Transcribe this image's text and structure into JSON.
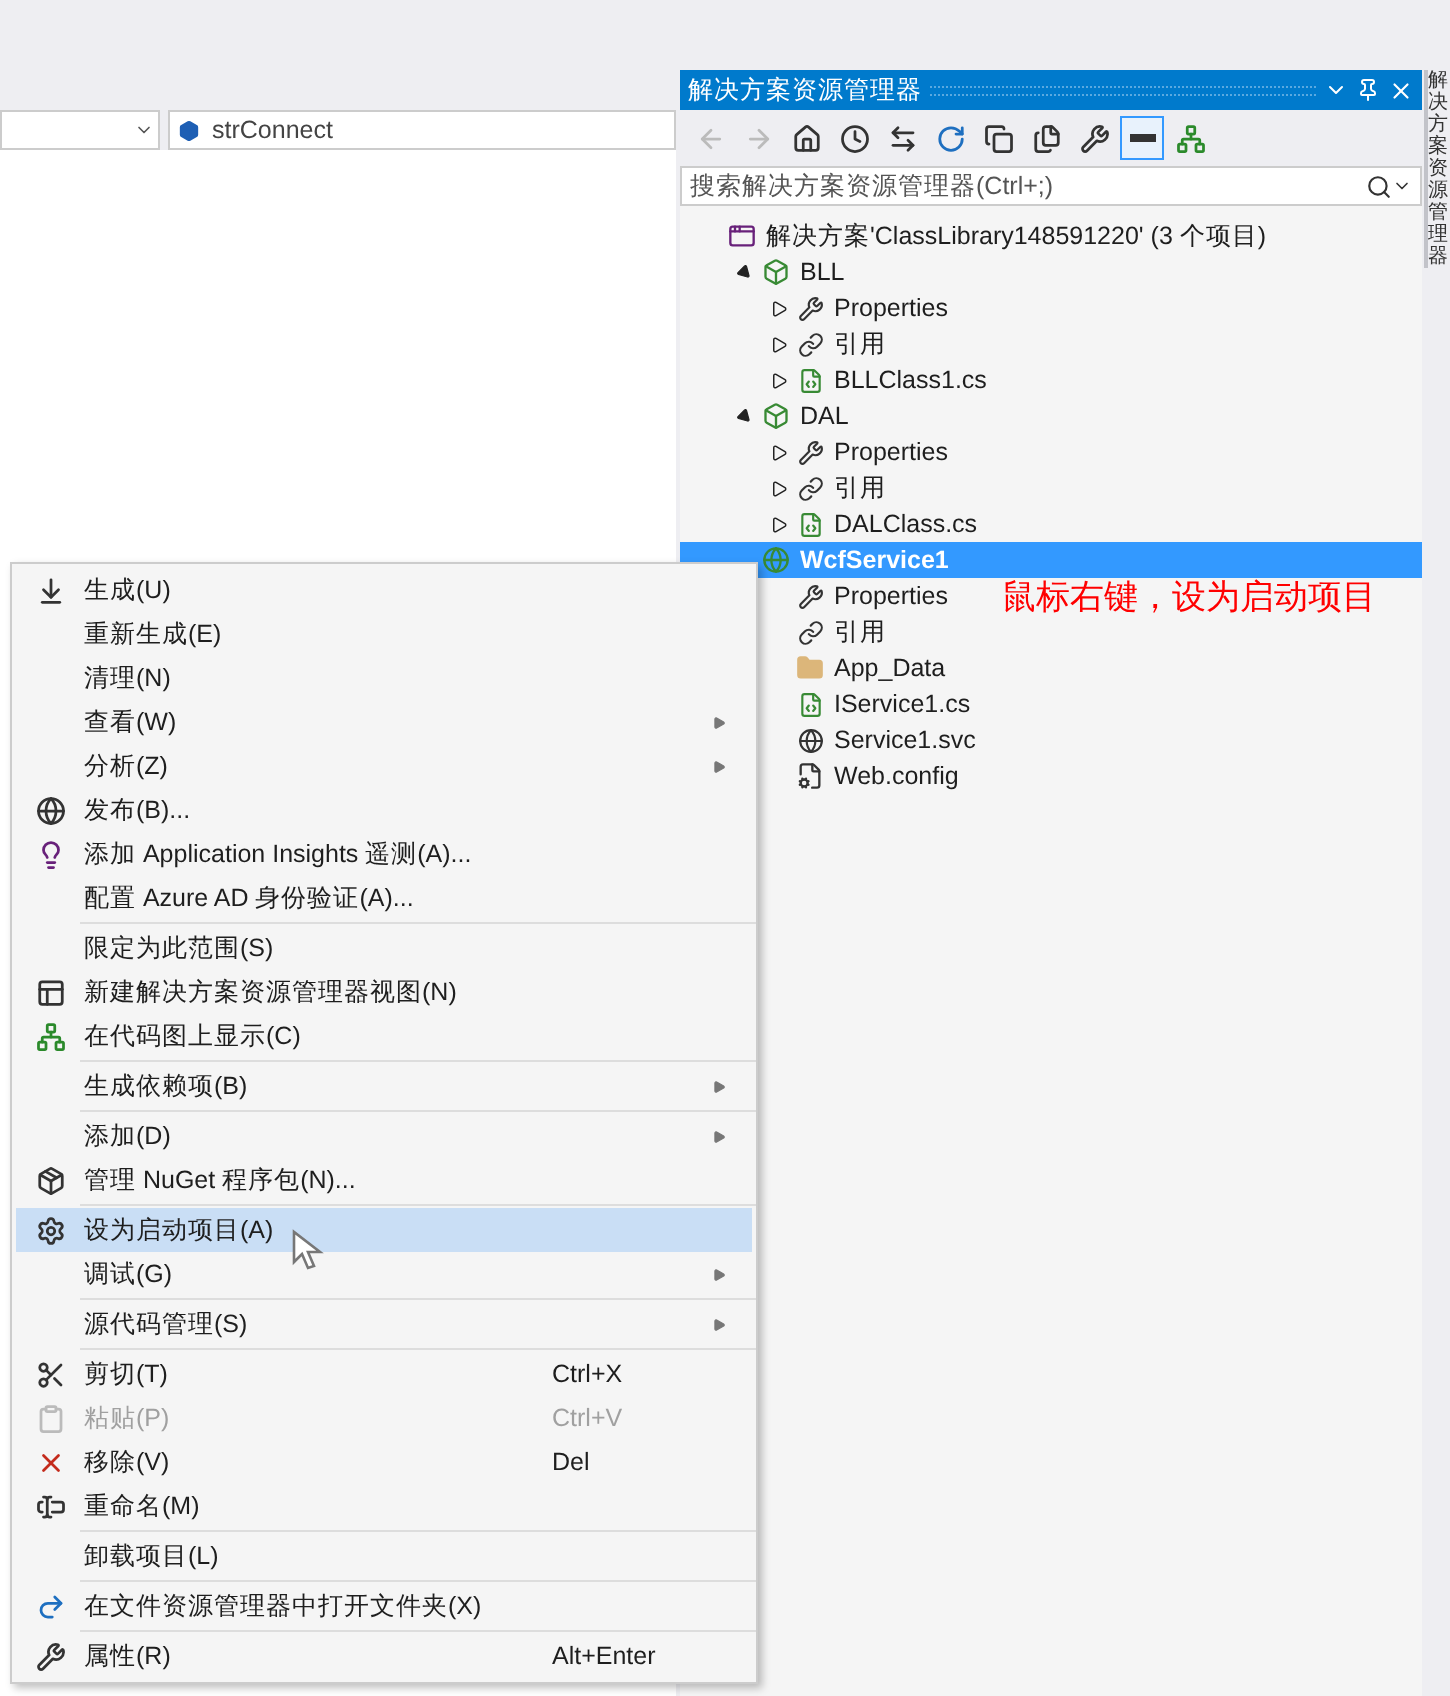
{
  "editor": {
    "member_combo": "strConnect"
  },
  "explorer": {
    "title": "解决方案资源管理器",
    "side_tab": "解决方案资源管理器",
    "toolbar": [
      {
        "kind": "back",
        "selected": false
      },
      {
        "kind": "forward",
        "selected": false
      },
      {
        "kind": "home",
        "selected": false
      },
      {
        "kind": "history",
        "selected": false
      },
      {
        "kind": "sync",
        "selected": false
      },
      {
        "kind": "refresh",
        "selected": false
      },
      {
        "kind": "collapse",
        "selected": false
      },
      {
        "kind": "showall",
        "selected": false
      },
      {
        "kind": "properties",
        "selected": false
      },
      {
        "kind": "preview",
        "selected": true
      },
      {
        "kind": "codemap",
        "selected": false
      }
    ],
    "search": {
      "placeholder": "搜索解决方案资源管理器(Ctrl+;)"
    },
    "tree": [
      {
        "kind": "solution",
        "label": "解决方案'ClassLibrary148591220' (3 个项目)",
        "selected": false,
        "children": [
          {
            "kind": "project",
            "label": "BLL",
            "expanded": true,
            "selected": false,
            "children": [
              {
                "kind": "wrench",
                "label": "Properties",
                "expanded": false,
                "selected": false
              },
              {
                "kind": "reference",
                "label": "引用",
                "expanded": false,
                "selected": false
              },
              {
                "kind": "csfile",
                "label": "BLLClass1.cs",
                "expanded": false,
                "selected": false
              }
            ]
          },
          {
            "kind": "project",
            "label": "DAL",
            "expanded": true,
            "selected": false,
            "children": [
              {
                "kind": "wrench",
                "label": "Properties",
                "expanded": false,
                "selected": false
              },
              {
                "kind": "reference",
                "label": "引用",
                "expanded": false,
                "selected": false
              },
              {
                "kind": "csfile",
                "label": "DALClass.cs",
                "expanded": false,
                "selected": false
              }
            ]
          },
          {
            "kind": "webproject",
            "label": "WcfService1",
            "selected": true,
            "children": [
              {
                "kind": "wrench",
                "label": "Properties",
                "selected": false
              },
              {
                "kind": "reference",
                "label": "引用",
                "selected": false
              },
              {
                "kind": "folder",
                "label": "App_Data",
                "selected": false
              },
              {
                "kind": "csfile",
                "label": "IService1.cs",
                "selected": false
              },
              {
                "kind": "svc",
                "label": "Service1.svc",
                "selected": false
              },
              {
                "kind": "config",
                "label": "Web.config",
                "selected": false
              }
            ]
          }
        ]
      }
    ]
  },
  "annotation": "鼠标右键，设为启动项目",
  "context_menu": {
    "groups": [
      {
        "items": [
          {
            "kind": "build",
            "label": "生成(U)",
            "selected": false,
            "disabled": false
          },
          {
            "label": "重新生成(E)",
            "selected": false,
            "disabled": false
          },
          {
            "label": "清理(N)",
            "selected": false,
            "disabled": false
          },
          {
            "label": "查看(W)",
            "submenu": true,
            "selected": false,
            "disabled": false
          },
          {
            "label": "分析(Z)",
            "submenu": true,
            "selected": false,
            "disabled": false
          },
          {
            "kind": "publish",
            "label": "发布(B)...",
            "selected": false,
            "disabled": false
          },
          {
            "kind": "insights",
            "label": "添加 Application Insights 遥测(A)...",
            "selected": false,
            "disabled": false
          },
          {
            "label": "配置 Azure AD 身份验证(A)...",
            "selected": false,
            "disabled": false
          }
        ]
      },
      {
        "items": [
          {
            "label": "限定为此范围(S)",
            "selected": false,
            "disabled": false
          },
          {
            "kind": "newview",
            "label": "新建解决方案资源管理器视图(N)",
            "selected": false,
            "disabled": false
          },
          {
            "kind": "codemap",
            "label": "在代码图上显示(C)",
            "selected": false,
            "disabled": false
          }
        ]
      },
      {
        "items": [
          {
            "label": "生成依赖项(B)",
            "submenu": true,
            "selected": false,
            "disabled": false
          }
        ]
      },
      {
        "items": [
          {
            "label": "添加(D)",
            "submenu": true,
            "selected": false,
            "disabled": false
          },
          {
            "kind": "nuget",
            "label": "管理 NuGet 程序包(N)...",
            "selected": false,
            "disabled": false
          }
        ]
      },
      {
        "items": [
          {
            "kind": "gear",
            "label": "设为启动项目(A)",
            "selected": true,
            "disabled": false
          },
          {
            "label": "调试(G)",
            "submenu": true,
            "selected": false,
            "disabled": false
          }
        ]
      },
      {
        "items": [
          {
            "label": "源代码管理(S)",
            "submenu": true,
            "selected": false,
            "disabled": false
          }
        ]
      },
      {
        "items": [
          {
            "kind": "cut",
            "label": "剪切(T)",
            "shortcut": "Ctrl+X",
            "selected": false,
            "disabled": false
          },
          {
            "kind": "paste",
            "label": "粘贴(P)",
            "shortcut": "Ctrl+V",
            "selected": false,
            "disabled": true
          },
          {
            "kind": "remove",
            "label": "移除(V)",
            "shortcut": "Del",
            "selected": false,
            "disabled": false
          },
          {
            "kind": "rename",
            "label": "重命名(M)",
            "selected": false,
            "disabled": false
          }
        ]
      },
      {
        "items": [
          {
            "label": "卸载项目(L)",
            "selected": false,
            "disabled": false
          }
        ]
      },
      {
        "items": [
          {
            "kind": "openfolder",
            "label": "在文件资源管理器中打开文件夹(X)",
            "selected": false,
            "disabled": false
          }
        ]
      },
      {
        "items": [
          {
            "kind": "wrench",
            "label": "属性(R)",
            "shortcut": "Alt+Enter",
            "selected": false,
            "disabled": false
          }
        ]
      }
    ]
  }
}
